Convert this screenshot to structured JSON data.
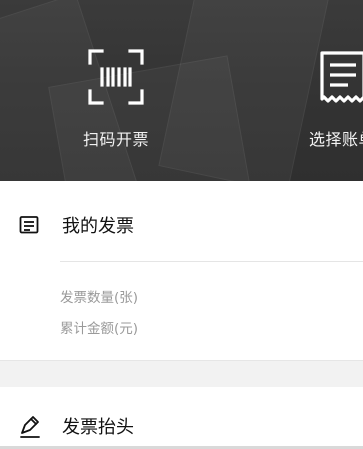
{
  "header": {
    "actions": [
      {
        "label": "扫码开票",
        "icon": "scan-barcode-icon"
      },
      {
        "label": "选择账单",
        "icon": "receipt-icon"
      }
    ]
  },
  "main": {
    "my_invoice": {
      "title": "我的发票",
      "icon": "invoice-list-icon"
    },
    "stats": {
      "count_label": "发票数量(张)",
      "amount_label": "累计金额(元)"
    },
    "invoice_title": {
      "title": "发票抬头",
      "icon": "pencil-edit-icon"
    }
  },
  "colors": {
    "header_bg": "#333333",
    "text_primary": "#111111",
    "text_secondary": "#9a9a9a",
    "background": "#f2f2f2"
  }
}
